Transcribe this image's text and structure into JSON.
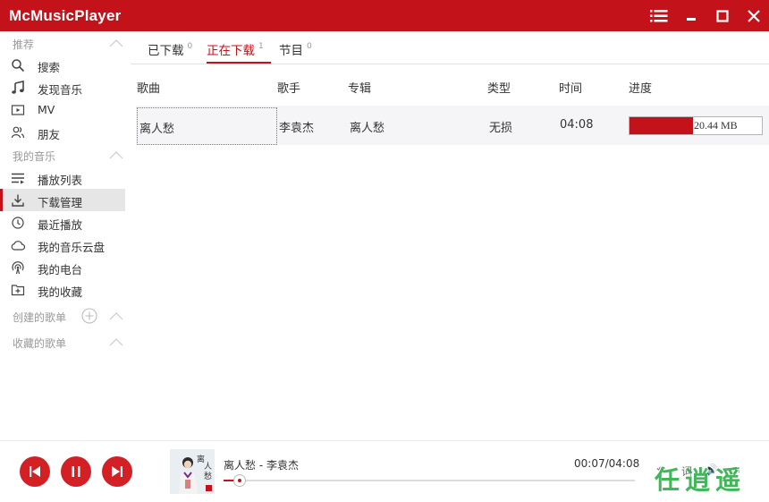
{
  "app": {
    "title": "McMusicPlayer"
  },
  "sidebar": {
    "sections": {
      "recommend": "推荐",
      "my_music": "我的音乐",
      "created": "创建的歌单",
      "favorited": "收藏的歌单"
    },
    "items": [
      {
        "label": "搜索",
        "icon": "search-icon"
      },
      {
        "label": "发现音乐",
        "icon": "music-note-icon"
      },
      {
        "label": "MV",
        "icon": "video-icon"
      },
      {
        "label": "朋友",
        "icon": "friends-icon"
      },
      {
        "label": "播放列表",
        "icon": "playlist-icon"
      },
      {
        "label": "下载管理",
        "icon": "download-icon",
        "active": true
      },
      {
        "label": "最近播放",
        "icon": "clock-icon"
      },
      {
        "label": "我的音乐云盘",
        "icon": "cloud-icon"
      },
      {
        "label": "我的电台",
        "icon": "radio-icon"
      },
      {
        "label": "我的收藏",
        "icon": "favorites-icon"
      }
    ]
  },
  "tabs": [
    {
      "label": "已下载",
      "count": "0"
    },
    {
      "label": "正在下载",
      "count": "1",
      "active": true
    },
    {
      "label": "节目",
      "count": "0"
    }
  ],
  "table": {
    "headers": {
      "song": "歌曲",
      "artist": "歌手",
      "album": "专辑",
      "type": "类型",
      "time": "时间",
      "progress": "进度"
    },
    "rows": [
      {
        "song": "离人愁",
        "artist": "李袁杰",
        "album": "离人愁",
        "type": "无损",
        "time": "04:08",
        "size": "20.44 MB",
        "progress": 0.48
      }
    ]
  },
  "player": {
    "now_playing": "离人愁 - 李袁杰",
    "time": "00:07/04:08",
    "position": 0.028,
    "controls": {
      "loop": "⟲",
      "lyric": "词",
      "volume": "🔊",
      "list": "≡"
    },
    "watermark": "任逍遥"
  },
  "colors": {
    "accent": "#c4121a",
    "button": "#d32025",
    "watermark": "#2fb24a"
  }
}
